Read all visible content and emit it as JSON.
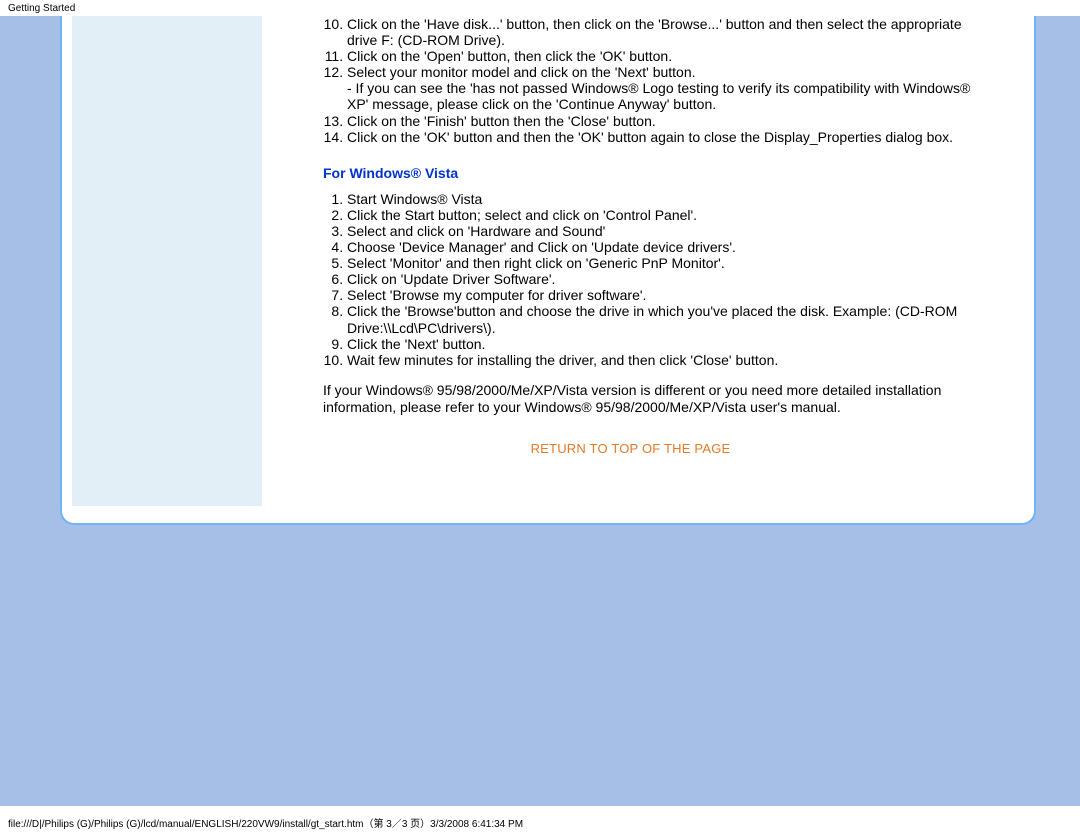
{
  "header": {
    "title": "Getting Started"
  },
  "xp_list_start": 10,
  "xp_steps": [
    "Click on the 'Have disk...' button, then click on the 'Browse...' button and then select the appropriate drive F: (CD-ROM Drive).",
    "Click on the 'Open' button, then click the 'OK' button.",
    "Select your monitor model and click on the 'Next' button.\n- If you can see the 'has not passed Windows® Logo testing to verify its compatibility with Windows® XP' message, please click on the 'Continue Anyway' button.",
    "Click on the 'Finish' button then the 'Close' button.",
    "Click on the 'OK' button and then the 'OK' button again to close the Display_Properties dialog box."
  ],
  "vista_heading": "For Windows® Vista",
  "vista_steps": [
    "Start Windows® Vista",
    "Click the Start button; select and click on 'Control Panel'.",
    "Select and click on 'Hardware and Sound'",
    "Choose 'Device Manager' and Click on 'Update device drivers'.",
    "Select 'Monitor' and then right click on 'Generic PnP Monitor'.",
    "Click on 'Update Driver Software'.",
    "Select 'Browse my computer for driver software'.",
    "Click the 'Browse'button and choose the drive in which you've placed the disk. Example: (CD-ROM Drive:\\\\Lcd\\PC\\drivers\\).",
    "Click the 'Next' button.",
    "Wait few minutes for installing the driver, and then click 'Close' button."
  ],
  "note": "If your Windows® 95/98/2000/Me/XP/Vista version is different or you need more detailed installation information, please refer to your Windows® 95/98/2000/Me/XP/Vista user's manual.",
  "return_link": "RETURN TO TOP OF THE PAGE",
  "footer": "file:///D|/Philips (G)/Philips (G)/lcd/manual/ENGLISH/220VW9/install/gt_start.htm（第 3／3 页）3/3/2008 6:41:34 PM"
}
